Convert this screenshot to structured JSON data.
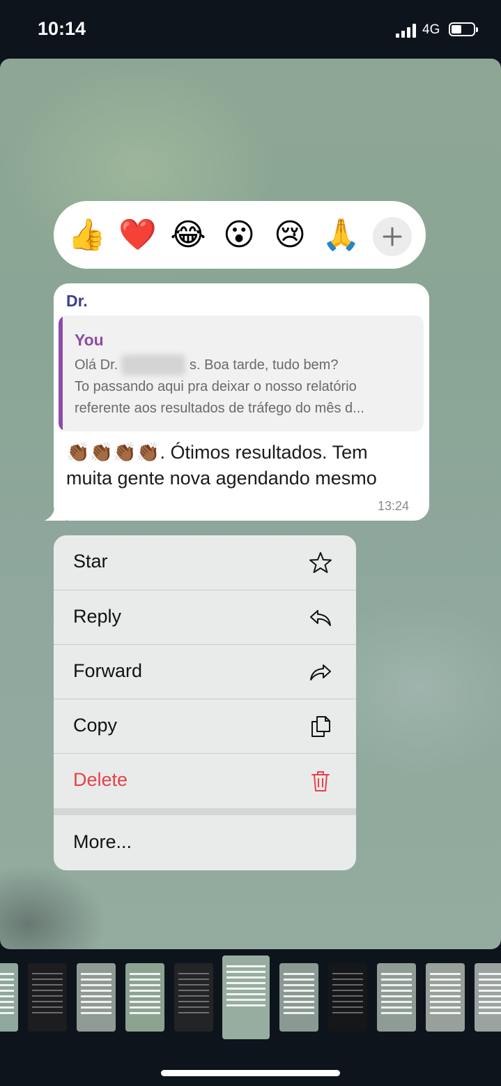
{
  "status_bar": {
    "time": "10:14",
    "network": "4G"
  },
  "reactions": {
    "emojis": [
      "👍",
      "❤️",
      "😂",
      "😮",
      "😢",
      "🙏"
    ],
    "add_label": "+"
  },
  "message": {
    "sender": "Dr.",
    "quote_author": "You",
    "quote_line1_a": "Olá Dr.",
    "quote_line1_b": "s. Boa tarde, tudo bem?",
    "quote_line2": "To passando aqui pra deixar o nosso relatório",
    "quote_line3": "referente aos resultados de tráfego do mês d...",
    "text_line1": "👏🏾👏🏾👏🏾👏🏾. Ótimos resultados. Tem",
    "text_line2": "muita gente nova agendando mesmo",
    "time": "13:24"
  },
  "menu": {
    "star": "Star",
    "reply": "Reply",
    "forward": "Forward",
    "copy": "Copy",
    "delete": "Delete",
    "more": "More...",
    "delete_color": "#e5414a"
  },
  "icons": [
    "star-icon",
    "reply-icon",
    "forward-icon",
    "copy-icon",
    "trash-icon",
    "plus-icon"
  ]
}
